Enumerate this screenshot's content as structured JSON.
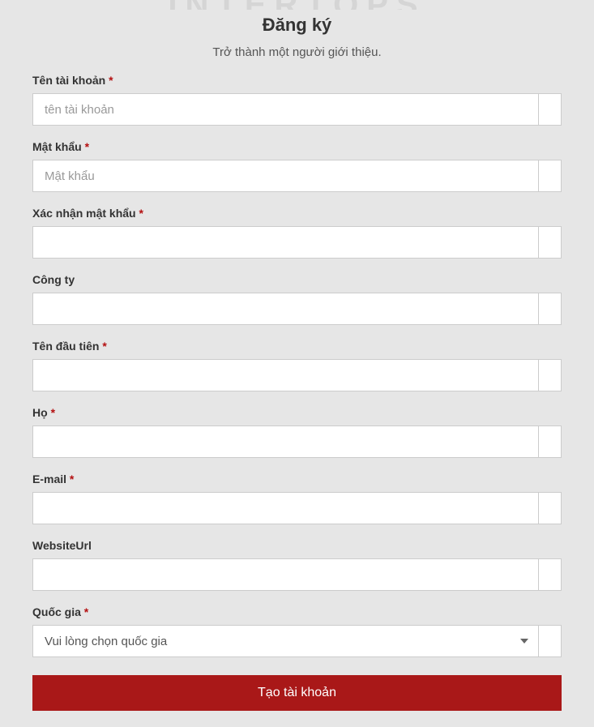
{
  "brand": "INTERTOPS",
  "title": "Đăng ký",
  "subtitle": "Trở thành một người giới thiệu.",
  "asterisk": "*",
  "fields": {
    "username": {
      "label": "Tên tài khoản",
      "required": true,
      "placeholder": "tên tài khoản",
      "value": ""
    },
    "password": {
      "label": "Mật khẩu",
      "required": true,
      "placeholder": "Mật khẩu",
      "value": ""
    },
    "confirm_password": {
      "label": "Xác nhận mật khẩu",
      "required": true,
      "placeholder": "",
      "value": ""
    },
    "company": {
      "label": "Công ty",
      "required": false,
      "placeholder": "",
      "value": ""
    },
    "first_name": {
      "label": "Tên đầu tiên",
      "required": true,
      "placeholder": "",
      "value": ""
    },
    "last_name": {
      "label": "Họ",
      "required": true,
      "placeholder": "",
      "value": ""
    },
    "email": {
      "label": "E-mail",
      "required": true,
      "placeholder": "",
      "value": ""
    },
    "website_url": {
      "label": "WebsiteUrl",
      "required": false,
      "placeholder": "",
      "value": ""
    },
    "country": {
      "label": "Quốc gia",
      "required": true,
      "selected": "Vui lòng chọn quốc gia"
    }
  },
  "submit_label": "Tạo tài khoản"
}
